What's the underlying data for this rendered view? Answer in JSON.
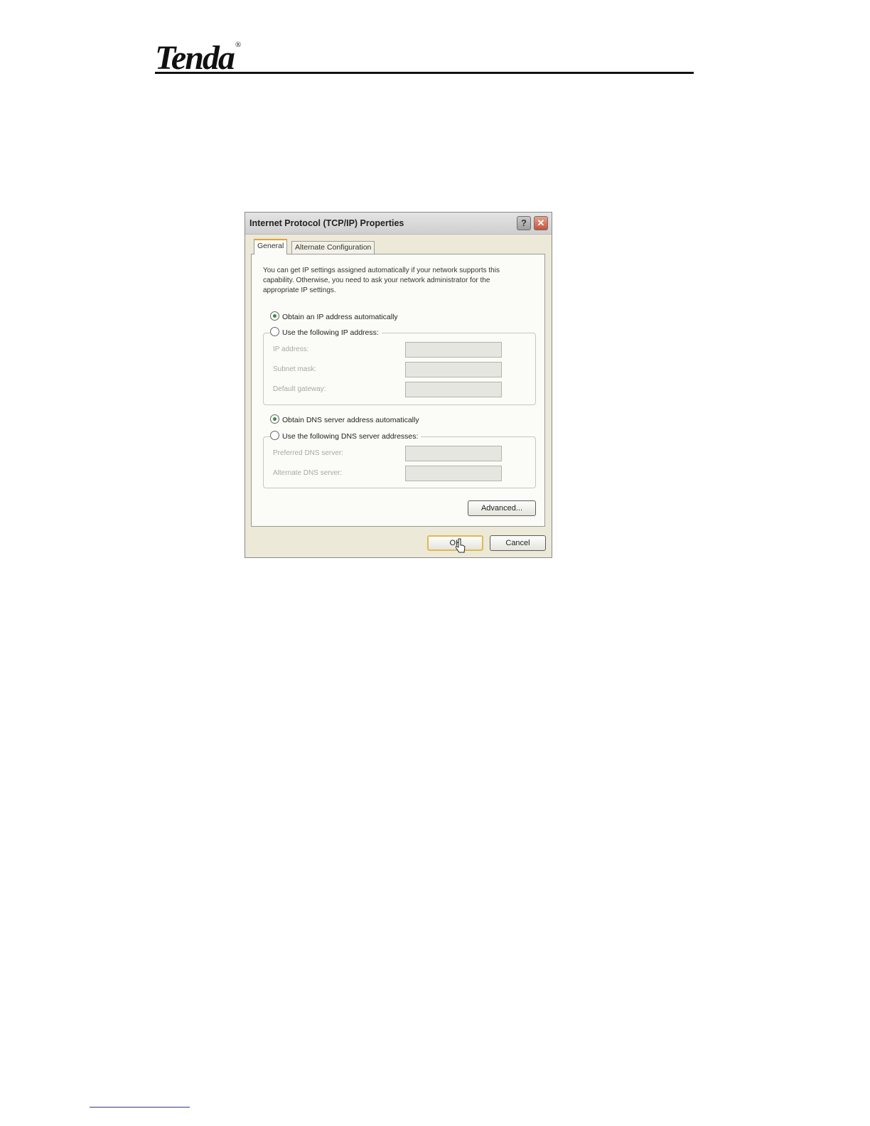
{
  "header": {
    "logo_text": "Tenda",
    "logo_mark": "®"
  },
  "dialog": {
    "title": "Internet Protocol (TCP/IP) Properties",
    "help_label": "?",
    "close_label": "✕",
    "tabs": [
      {
        "label": "General",
        "active": true
      },
      {
        "label": "Alternate Configuration",
        "active": false
      }
    ],
    "intro_text": "You can get IP settings assigned automatically if your network supports this capability. Otherwise, you need to ask your network administrator for the appropriate IP settings.",
    "ip_options": {
      "auto_label": "Obtain an IP address automatically",
      "manual_label": "Use the following IP address:",
      "selected": "auto"
    },
    "ip_fields": [
      {
        "label": "IP address:",
        "value": ""
      },
      {
        "label": "Subnet mask:",
        "value": ""
      },
      {
        "label": "Default gateway:",
        "value": ""
      }
    ],
    "dns_options": {
      "auto_label": "Obtain DNS server address automatically",
      "manual_label": "Use the following DNS server addresses:",
      "selected": "auto"
    },
    "dns_fields": [
      {
        "label": "Preferred DNS server:",
        "value": ""
      },
      {
        "label": "Alternate DNS server:",
        "value": ""
      }
    ],
    "advanced_label": "Advanced...",
    "ok_label": "OK",
    "cancel_label": "Cancel"
  }
}
